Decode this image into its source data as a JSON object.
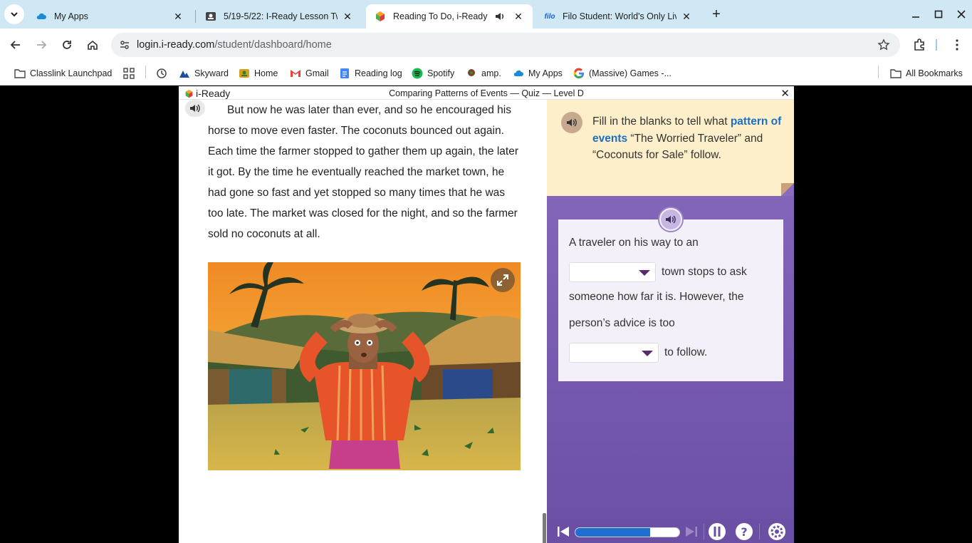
{
  "browser": {
    "tabs": [
      {
        "title": "My Apps",
        "active": false
      },
      {
        "title": "5/19-5/22: I-Ready Lesson Twe",
        "active": false
      },
      {
        "title": "Reading To Do, i-Ready",
        "active": true,
        "audio": true
      },
      {
        "title": "Filo Student: World's Only Live I",
        "active": false
      }
    ],
    "url_host": "login.i-ready.com",
    "url_path": "/student/dashboard/home",
    "bookmarks": [
      {
        "label": "Classlink Launchpad",
        "icon": "folder-icon"
      },
      {
        "label": "",
        "icon": "apps-grid-icon"
      },
      {
        "label": "",
        "icon": "history-icon"
      },
      {
        "label": "Skyward",
        "icon": "skyward-icon"
      },
      {
        "label": "Home",
        "icon": "home-bookmark-icon"
      },
      {
        "label": "Gmail",
        "icon": "gmail-icon"
      },
      {
        "label": "Reading log",
        "icon": "docs-icon"
      },
      {
        "label": "Spotify",
        "icon": "spotify-icon"
      },
      {
        "label": "amp.",
        "icon": "amp-icon"
      },
      {
        "label": "My Apps",
        "icon": "cloud-icon"
      },
      {
        "label": "(Massive) Games -...",
        "icon": "google-icon"
      }
    ],
    "all_bookmarks": "All Bookmarks"
  },
  "lesson": {
    "brand": "i-Ready",
    "title": "Comparing Patterns of Events — Quiz — Level D",
    "close": "✕"
  },
  "passage": {
    "text": "But now he was later than ever, and so he encouraged his horse to move even faster. The coconuts bounced out again. Each time the farmer stopped to gather them up again, the later it got. By the time he eventually reached the market town, he had gone so fast and yet stopped so many times that he was too late. The market was closed for the night, and so the farmer sold no coconuts at all."
  },
  "quiz": {
    "prompt_pre": "Fill in the blanks to tell what ",
    "prompt_keyword": "pattern of events",
    "prompt_post": " “The Worried Traveler” and “Coconuts for Sale” follow.",
    "line1": "A traveler on his way to an",
    "line2_after": "town stops to ask",
    "line3": "someone how far it is. However, the",
    "line4": "person’s advice is too",
    "line5_after": "to follow.",
    "dropdown1_value": "",
    "dropdown2_value": ""
  },
  "player": {
    "progress": 0.72
  },
  "colors": {
    "keyword": "#1a6fc5",
    "quiz_bg": "#7b5cb2",
    "prompt_bg": "#fdefc9",
    "progress_fill": "#1e6fd0"
  }
}
